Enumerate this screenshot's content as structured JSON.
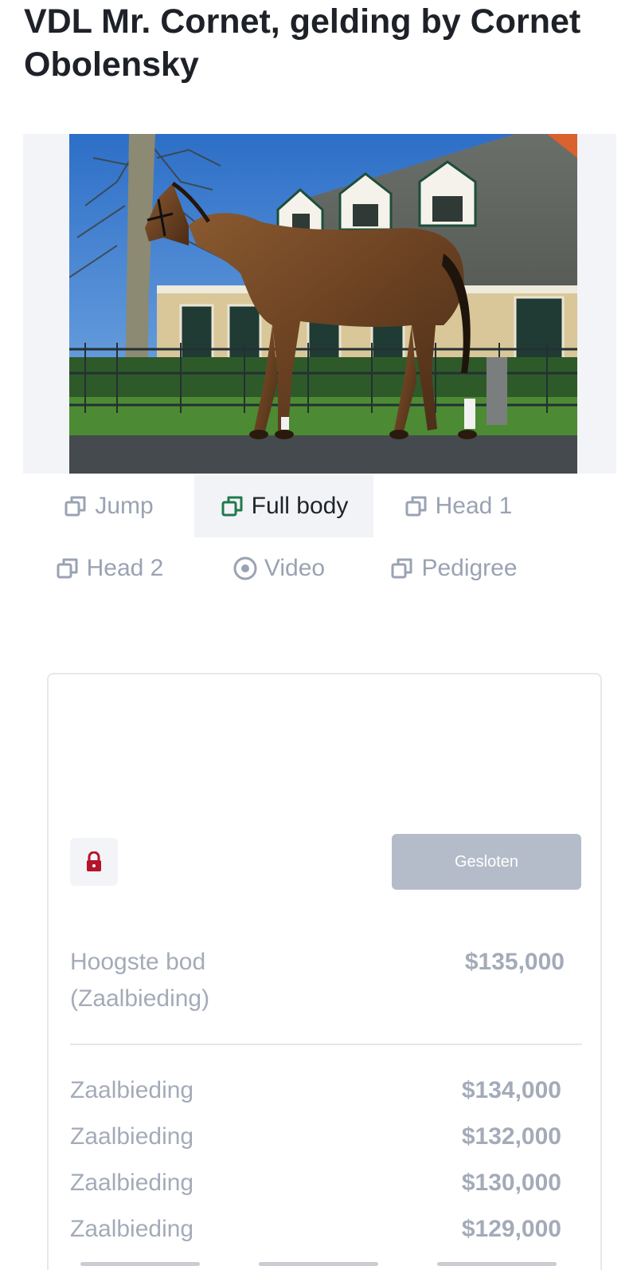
{
  "page": {
    "title": "VDL Mr. Cornet, gelding by Cornet Obolensky"
  },
  "gallery": {
    "tabs": [
      {
        "label": "Jump",
        "icon": "copy-icon",
        "active": false
      },
      {
        "label": "Full body",
        "icon": "copy-icon",
        "active": true
      },
      {
        "label": "Head 1",
        "icon": "copy-icon",
        "active": false
      },
      {
        "label": "Head 2",
        "icon": "copy-icon",
        "active": false
      },
      {
        "label": "Video",
        "icon": "play-circle-icon",
        "active": false
      },
      {
        "label": "Pedigree",
        "icon": "copy-icon",
        "active": false
      }
    ]
  },
  "auction": {
    "status_button": "Gesloten",
    "lock_icon": "lock-icon",
    "highest_bid_label": "Hoogste bod (Zaalbieding)",
    "highest_bid_amount": "$135,000",
    "bids": [
      {
        "label": "Zaalbieding",
        "amount": "$134,000"
      },
      {
        "label": "Zaalbieding",
        "amount": "$132,000"
      },
      {
        "label": "Zaalbieding",
        "amount": "$130,000"
      },
      {
        "label": "Zaalbieding",
        "amount": "$129,000"
      }
    ]
  },
  "colors": {
    "accent_green": "#1f7a4d",
    "lock_red": "#b3142c",
    "muted_text": "#a4abb8",
    "button_gray": "#b5bcc9"
  }
}
